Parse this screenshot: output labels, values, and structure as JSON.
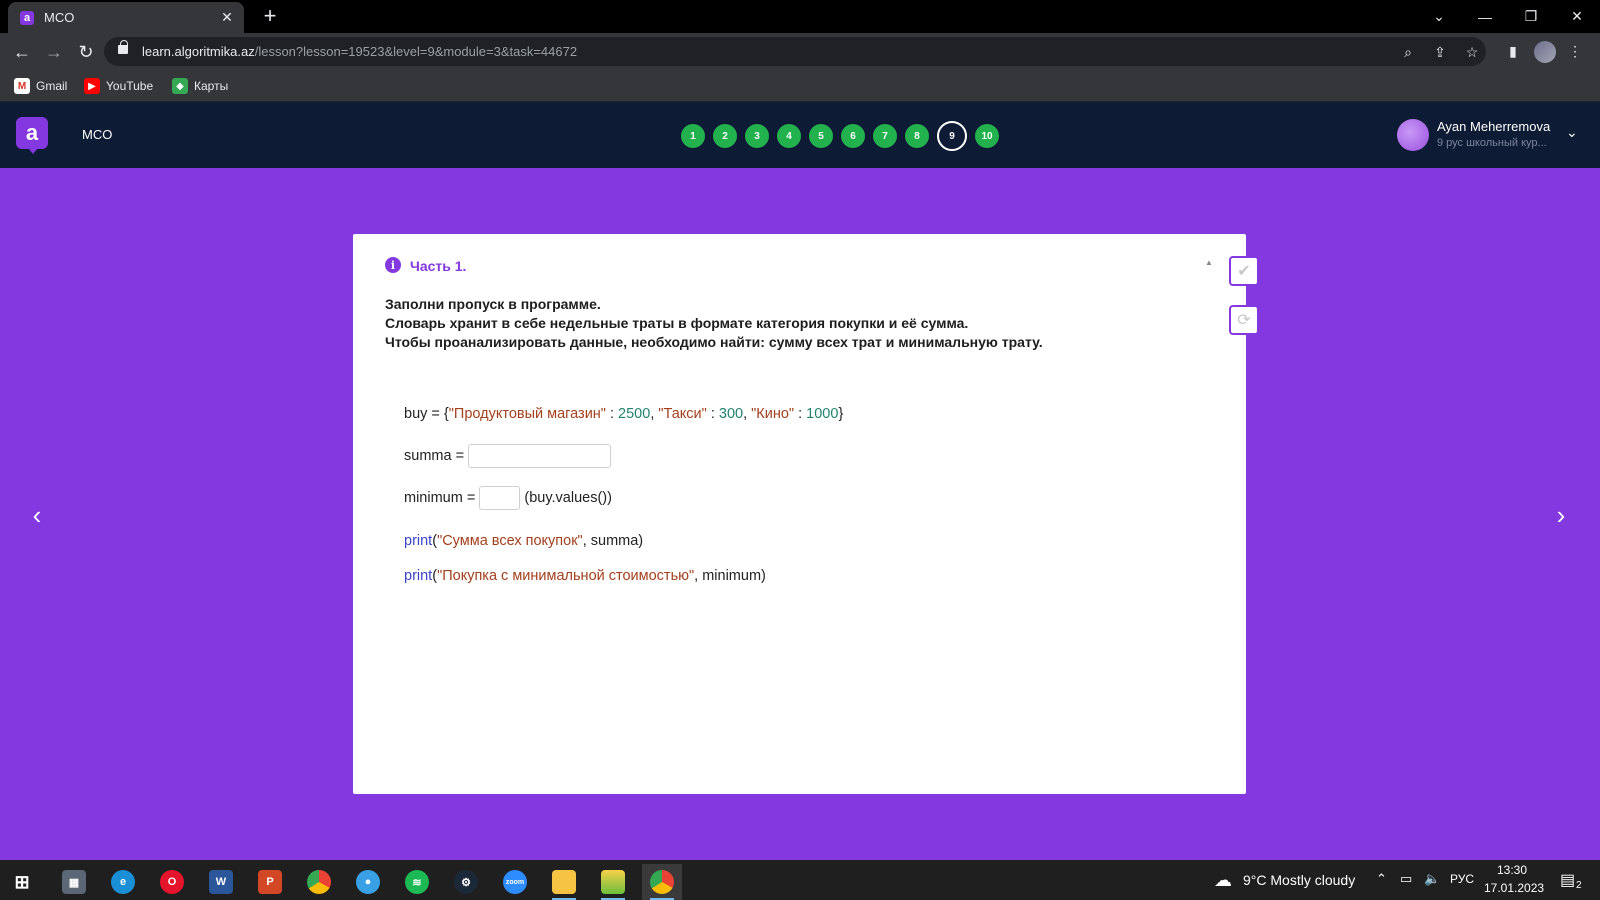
{
  "browser": {
    "tab_title": "MCO",
    "tab_favicon": "a",
    "url_host": "learn.algoritmika.az",
    "url_path": "/lesson?lesson=19523&level=9&module=3&task=44672",
    "bookmarks": [
      {
        "label": "Gmail",
        "icon": "gmail-icon"
      },
      {
        "label": "YouTube",
        "icon": "youtube-icon"
      },
      {
        "label": "Карты",
        "icon": "maps-icon"
      }
    ]
  },
  "app": {
    "logo_letter": "a",
    "course_title": "MCO",
    "steps": [
      "1",
      "2",
      "3",
      "4",
      "5",
      "6",
      "7",
      "8",
      "9",
      "10"
    ],
    "active_step": "9",
    "user_name": "Ayan Meherremova",
    "user_group": "9 рус школьный кур..."
  },
  "card": {
    "part_title": "Часть 1.",
    "task_lines": [
      "Заполни пропуск в программе.",
      "Словарь хранит в себе недельные траты в формате категория покупки и её сумма.",
      "Чтобы проанализировать данные, необходимо найти: сумму всех трат и минимальную трату."
    ],
    "code": {
      "line1": {
        "prefix": "buy = {",
        "k1": "\"Продуктовый магазин\"",
        "sep1": " : ",
        "v1": "2500",
        "c1": ", ",
        "k2": "\"Такси\"",
        "sep2": " : ",
        "v2": "300",
        "c2": ", ",
        "k3": "\"Кино\"",
        "sep3": " : ",
        "v3": "1000",
        "suffix": "}"
      },
      "line2": {
        "prefix": "summa = ",
        "blank_value": ""
      },
      "line3": {
        "prefix": "minimum = ",
        "blank_value": "",
        "suffix": "(buy.values())"
      },
      "line4": {
        "fn": "print",
        "open": "(",
        "str": "\"Сумма всех покупок\"",
        "rest": ", summa)"
      },
      "line5": {
        "fn": "print",
        "open": "(",
        "str": "\"Покупка с минимальной стоимостью\"",
        "rest": ", minimum)"
      }
    }
  },
  "taskbar": {
    "weather": "9°C  Mostly cloudy",
    "lang": "РУС",
    "time": "13:30",
    "date": "17.01.2023",
    "notifications": "2"
  },
  "colors": {
    "accent": "#8338e0",
    "header_bg": "#0e1b35",
    "step_done": "#23b14d"
  }
}
